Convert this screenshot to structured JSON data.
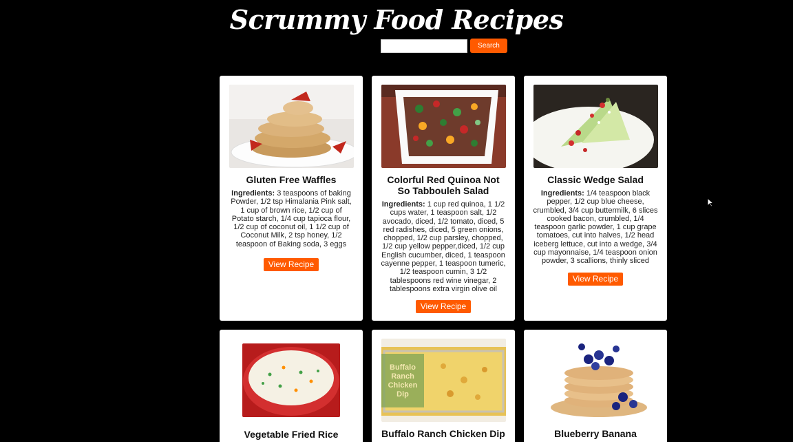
{
  "header": {
    "title": "Scrummy Food Recipes",
    "search_placeholder": "",
    "search_label": "Search"
  },
  "recipes": [
    {
      "title": "Gluten Free Waffles",
      "ingredients_label": "Ingredients:",
      "ingredients": "3 teaspoons of baking Powder, 1/2 tsp Himalania Pink salt, 1 cup of brown rice, 1/2 cup of Potato starch, 1/4 cup tapioca flour, 1/2 cup of coconut oil, 1 1/2 cup of Coconut Milk, 2 tsp honey, 1/2 teaspoon of Baking soda, 3 eggs",
      "button": "View Recipe"
    },
    {
      "title": "Colorful Red Quinoa Not So Tabbouleh Salad",
      "ingredients_label": "Ingredients:",
      "ingredients": "1 cup red quinoa, 1 1/2 cups water, 1 teaspoon salt, 1/2 avocado, diced, 1/2 tomato, diced, 5 red radishes, diced, 5 green onions, chopped, 1/2 cup parsley, chopped, 1/2 cup yellow pepper,diced, 1/2 cup English cucumber, diced, 1 teaspoon cayenne pepper, 1 teaspoon tumeric, 1/2 teaspoon cumin, 3 1/2 tablespoons red wine vinegar, 2 tablespoons extra virgin olive oil",
      "button": "View Recipe"
    },
    {
      "title": "Classic Wedge Salad",
      "ingredients_label": "Ingredients:",
      "ingredients": "1/4 teaspoon black pepper, 1/2 cup blue cheese, crumbled, 3/4 cup buttermilk, 6 slices cooked bacon, crumbled, 1/4 teaspoon garlic powder, 1 cup grape tomatoes, cut into halves, 1/2 head iceberg lettuce, cut into a wedge, 3/4 cup mayonnaise, 1/4 teaspoon onion powder, 3 scallions, thinly sliced",
      "button": "View Recipe"
    },
    {
      "title": "Vegetable Fried Rice"
    },
    {
      "title": "Buffalo Ranch Chicken Dip",
      "image_overlay_text": "Buffalo Ranch Chicken Dip"
    },
    {
      "title": "Blueberry Banana"
    }
  ],
  "colors": {
    "background": "#000000",
    "accent": "#ff5a00",
    "card": "#ffffff"
  }
}
